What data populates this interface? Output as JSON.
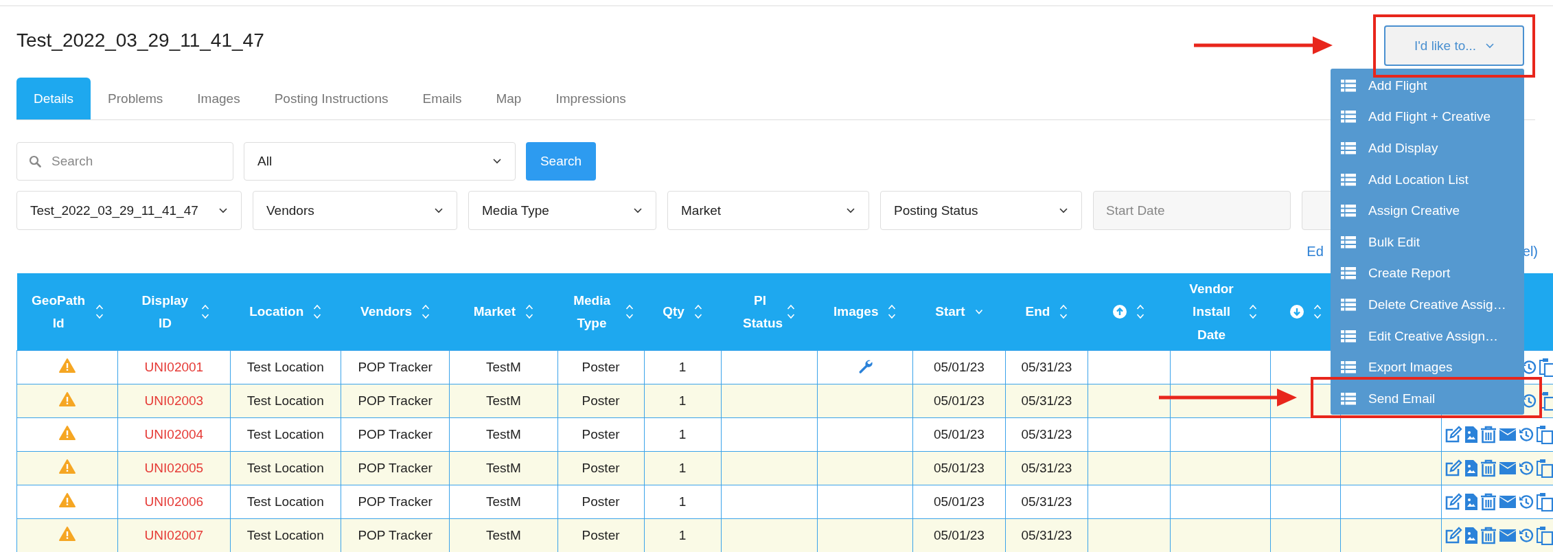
{
  "title": "Test_2022_03_29_11_41_47",
  "action_button": {
    "label": "I'd like to...",
    "expanded": true
  },
  "action_menu": [
    {
      "label": "Add Flight"
    },
    {
      "label": "Add Flight + Creative"
    },
    {
      "label": "Add Display"
    },
    {
      "label": "Add Location List"
    },
    {
      "label": "Assign Creative"
    },
    {
      "label": "Bulk Edit"
    },
    {
      "label": "Create Report"
    },
    {
      "label": "Delete Creative Assig…"
    },
    {
      "label": "Edit Creative Assign…"
    },
    {
      "label": "Export Images"
    },
    {
      "label": "Send Email"
    }
  ],
  "tabs": [
    {
      "label": "Details",
      "selected": true
    },
    {
      "label": "Problems",
      "selected": false
    },
    {
      "label": "Images",
      "selected": false
    },
    {
      "label": "Posting Instructions",
      "selected": false
    },
    {
      "label": "Emails",
      "selected": false
    },
    {
      "label": "Map",
      "selected": false
    },
    {
      "label": "Impressions",
      "selected": false
    }
  ],
  "search": {
    "placeholder": "Search"
  },
  "scope_select": {
    "value": "All"
  },
  "search_button": "Search",
  "filters": [
    {
      "kind": "select",
      "value": "Test_2022_03_29_11_41_47"
    },
    {
      "kind": "select",
      "value": "Vendors"
    },
    {
      "kind": "select",
      "value": "Media Type"
    },
    {
      "kind": "select",
      "value": "Market"
    },
    {
      "kind": "select",
      "value": "Posting Status"
    },
    {
      "kind": "date",
      "placeholder": "Start Date"
    },
    {
      "kind": "date"
    }
  ],
  "link_fragments": [
    "Ed",
    "el)"
  ],
  "columns": [
    {
      "label": "GeoPath Id",
      "sorted": false
    },
    {
      "label": "Display ID",
      "sorted": false
    },
    {
      "label": "Location",
      "sorted": false
    },
    {
      "label": "Vendors",
      "sorted": false
    },
    {
      "label": "Market",
      "sorted": false
    },
    {
      "label": "Media Type",
      "sorted": false
    },
    {
      "label": "Qty",
      "sorted": false
    },
    {
      "label": "PI Status",
      "sorted": false
    },
    {
      "label": "Images",
      "sorted": false
    },
    {
      "label": "Start",
      "sorted": true
    },
    {
      "label": "End",
      "sorted": false
    },
    {
      "kind": "up",
      "sorted": false
    },
    {
      "label": "Vendor Install Date",
      "sorted": false
    },
    {
      "kind": "down",
      "sorted": false
    },
    {},
    {}
  ],
  "rows": [
    {
      "warning": true,
      "display_id": "UNI02001",
      "location": "Test Location",
      "vendor": "POP Tracker",
      "market": "TestM",
      "media_type": "Poster",
      "qty": "1",
      "has_images": true,
      "start": "05/01/23",
      "end": "05/31/23"
    },
    {
      "warning": true,
      "display_id": "UNI02003",
      "location": "Test Location",
      "vendor": "POP Tracker",
      "market": "TestM",
      "media_type": "Poster",
      "qty": "1",
      "has_images": false,
      "start": "05/01/23",
      "end": "05/31/23"
    },
    {
      "warning": true,
      "display_id": "UNI02004",
      "location": "Test Location",
      "vendor": "POP Tracker",
      "market": "TestM",
      "media_type": "Poster",
      "qty": "1",
      "has_images": false,
      "start": "05/01/23",
      "end": "05/31/23"
    },
    {
      "warning": true,
      "display_id": "UNI02005",
      "location": "Test Location",
      "vendor": "POP Tracker",
      "market": "TestM",
      "media_type": "Poster",
      "qty": "1",
      "has_images": false,
      "start": "05/01/23",
      "end": "05/31/23"
    },
    {
      "warning": true,
      "display_id": "UNI02006",
      "location": "Test Location",
      "vendor": "POP Tracker",
      "market": "TestM",
      "media_type": "Poster",
      "qty": "1",
      "has_images": false,
      "start": "05/01/23",
      "end": "05/31/23"
    },
    {
      "warning": true,
      "display_id": "UNI02007",
      "location": "Test Location",
      "vendor": "POP Tracker",
      "market": "TestM",
      "media_type": "Poster",
      "qty": "1",
      "has_images": false,
      "start": "05/01/23",
      "end": "05/31/23"
    }
  ]
}
